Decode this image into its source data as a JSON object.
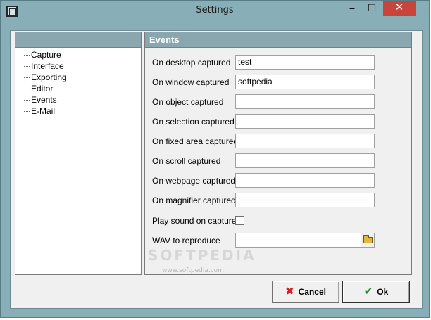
{
  "window": {
    "title": "Settings",
    "minimize_glyph": "–",
    "maximize_glyph": "☐",
    "close_glyph": "✕"
  },
  "tree": {
    "items": [
      {
        "label": "Capture"
      },
      {
        "label": "Interface"
      },
      {
        "label": "Exporting"
      },
      {
        "label": "Editor"
      },
      {
        "label": "Events"
      },
      {
        "label": "E-Mail"
      }
    ]
  },
  "panel": {
    "title": "Events",
    "rows": [
      {
        "label": "On desktop captured",
        "value": "test"
      },
      {
        "label": "On window captured",
        "value": "softpedia"
      },
      {
        "label": "On object captured",
        "value": ""
      },
      {
        "label": "On selection captured",
        "value": ""
      },
      {
        "label": "On fixed area captured",
        "value": ""
      },
      {
        "label": "On scroll captured",
        "value": ""
      },
      {
        "label": "On webpage captured",
        "value": ""
      },
      {
        "label": "On magnifier captured",
        "value": ""
      }
    ],
    "play_sound_label": "Play sound on capture",
    "play_sound_checked": false,
    "wav_label": "WAV to reproduce",
    "wav_value": ""
  },
  "watermark": {
    "big": "SOFTPEDIA",
    "small": "www.softpedia.com"
  },
  "buttons": {
    "cancel_label": "Cancel",
    "cancel_icon": "✖",
    "ok_label": "Ok",
    "ok_icon": "✔"
  },
  "colors": {
    "accent": "#88aeb8",
    "header": "#8aa6ae",
    "close": "#c7453a"
  },
  "icons": {
    "app": "app-icon",
    "browse": "folder-open-icon",
    "cancel": "x-icon",
    "ok": "checkmark-icon"
  }
}
